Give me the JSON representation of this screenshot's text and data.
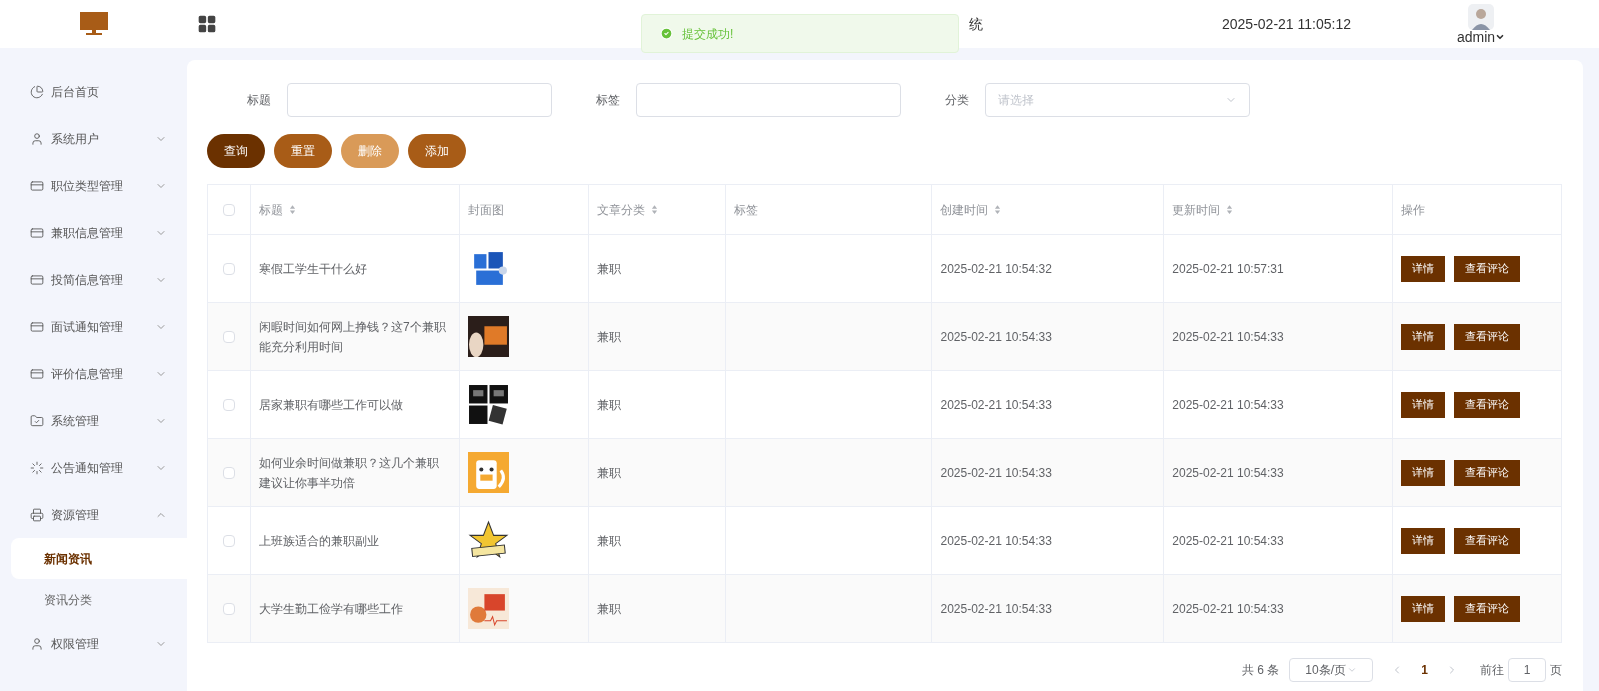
{
  "header": {
    "title": "统",
    "datetime": "2025-02-21 11:05:12",
    "user": "admin"
  },
  "toast": {
    "kind": "success",
    "message": "提交成功!"
  },
  "sidebar": {
    "items": [
      {
        "label": "后台首页"
      },
      {
        "label": "系统用户",
        "expanded": false
      },
      {
        "label": "职位类型管理",
        "expanded": false
      },
      {
        "label": "兼职信息管理",
        "expanded": false
      },
      {
        "label": "投简信息管理",
        "expanded": false
      },
      {
        "label": "面试通知管理",
        "expanded": false
      },
      {
        "label": "评价信息管理",
        "expanded": false
      },
      {
        "label": "系统管理",
        "expanded": false
      },
      {
        "label": "公告通知管理",
        "expanded": false
      },
      {
        "label": "资源管理",
        "expanded": true,
        "children": [
          {
            "label": "新闻资讯",
            "selected": true
          },
          {
            "label": "资讯分类",
            "selected": false
          }
        ]
      },
      {
        "label": "权限管理",
        "expanded": false
      }
    ]
  },
  "filters": [
    {
      "label": "标题",
      "kind": "text"
    },
    {
      "label": "标签",
      "kind": "text"
    },
    {
      "label": "分类",
      "kind": "select",
      "placeholder": "请选择"
    }
  ],
  "buttons": [
    {
      "label": "查询",
      "kind": "dark"
    },
    {
      "label": "重置",
      "kind": "mid"
    },
    {
      "label": "删除",
      "kind": "light"
    },
    {
      "label": "添加",
      "kind": "mid"
    }
  ],
  "table": {
    "all_checked": false,
    "columns": [
      {
        "label": "标题",
        "sortable": true
      },
      {
        "label": "封面图",
        "sortable": false
      },
      {
        "label": "文章分类",
        "sortable": true
      },
      {
        "label": "标签",
        "sortable": false
      },
      {
        "label": "创建时间",
        "sortable": true
      },
      {
        "label": "更新时间",
        "sortable": true
      },
      {
        "label": "操作",
        "sortable": false
      }
    ],
    "rows": [
      {
        "checked": false,
        "title": "寒假工学生干什么好",
        "category": "兼职",
        "created": "2025-02-21 10:54:32",
        "updated": "2025-02-21 10:57:31",
        "actions": [
          "详情",
          "查看评论"
        ]
      },
      {
        "checked": false,
        "title": "闲暇时间如何网上挣钱？这7个兼职能充分利用时间",
        "category": "兼职",
        "created": "2025-02-21 10:54:33",
        "updated": "2025-02-21 10:54:33",
        "actions": [
          "详情",
          "查看评论"
        ]
      },
      {
        "checked": false,
        "title": "居家兼职有哪些工作可以做",
        "category": "兼职",
        "created": "2025-02-21 10:54:33",
        "updated": "2025-02-21 10:54:33",
        "actions": [
          "详情",
          "查看评论"
        ]
      },
      {
        "checked": false,
        "title": "如何业余时间做兼职？这几个兼职建议让你事半功倍",
        "category": "兼职",
        "created": "2025-02-21 10:54:33",
        "updated": "2025-02-21 10:54:33",
        "actions": [
          "详情",
          "查看评论"
        ]
      },
      {
        "checked": false,
        "title": "上班族适合的兼职副业",
        "category": "兼职",
        "created": "2025-02-21 10:54:33",
        "updated": "2025-02-21 10:54:33",
        "actions": [
          "详情",
          "查看评论"
        ]
      },
      {
        "checked": false,
        "title": "大学生勤工俭学有哪些工作",
        "category": "兼职",
        "created": "2025-02-21 10:54:33",
        "updated": "2025-02-21 10:54:33",
        "actions": [
          "详情",
          "查看评论"
        ]
      }
    ]
  },
  "pagination": {
    "total": "共 6 条",
    "page_size": "10条/页",
    "pages": [
      {
        "label": "1",
        "selected": true
      }
    ],
    "goto_label": "前往",
    "goto_value": "1",
    "goto_suffix": "页"
  }
}
